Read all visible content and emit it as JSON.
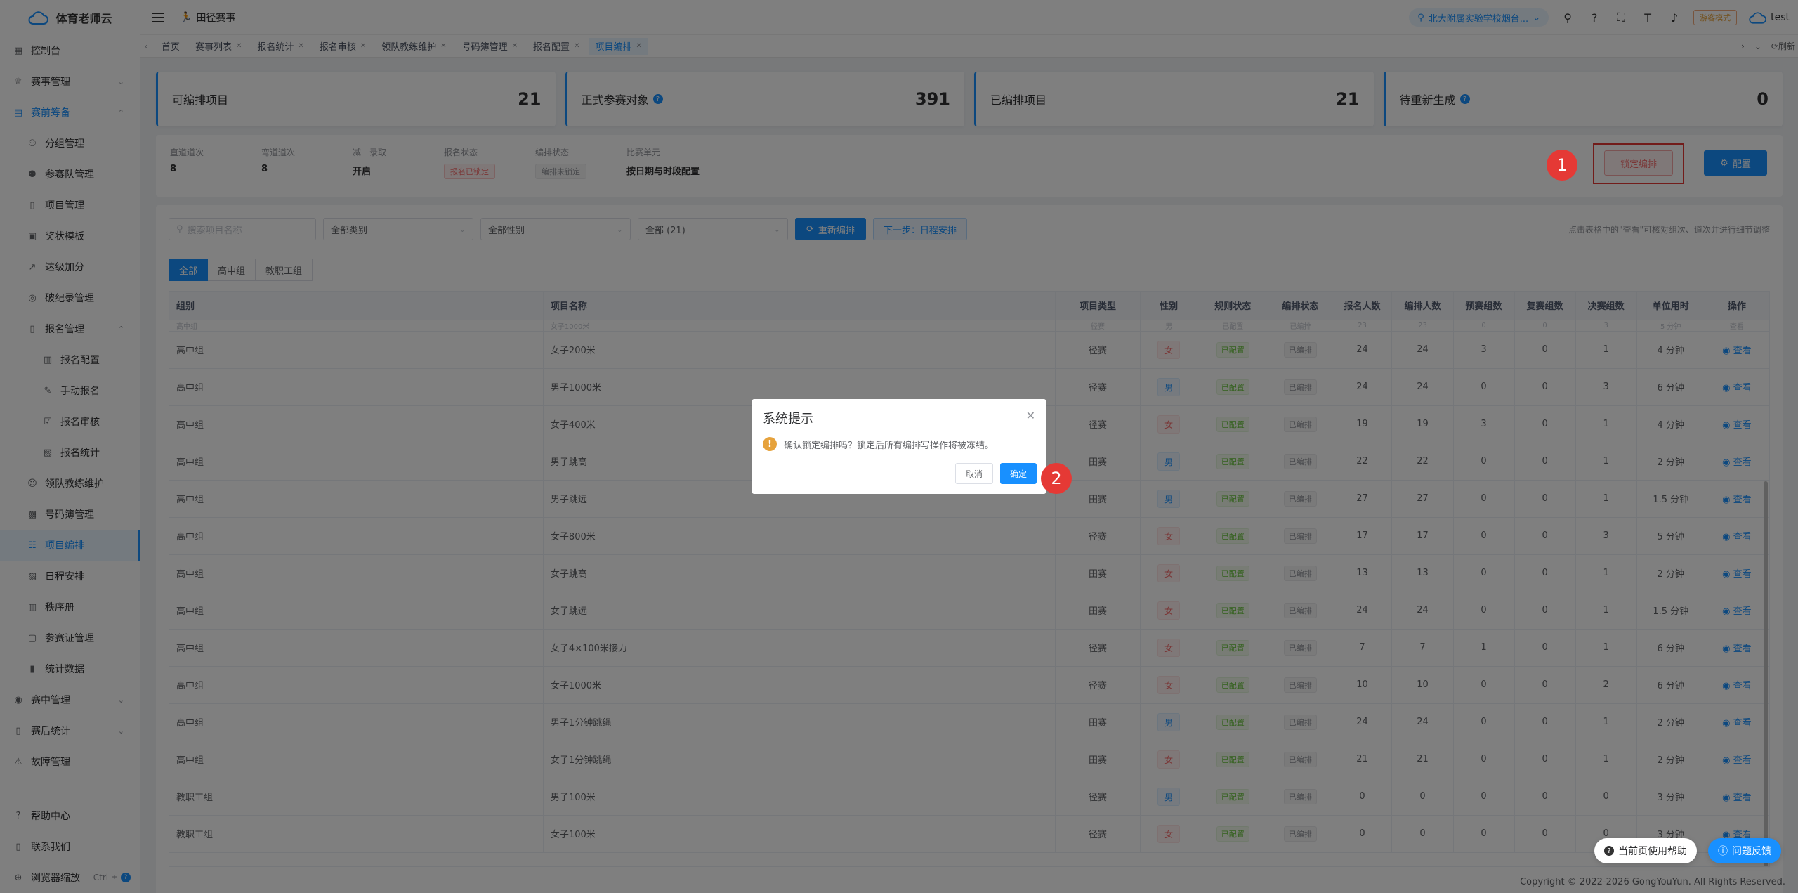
{
  "app": {
    "title": "体育老师云"
  },
  "sidebar": {
    "items": [
      {
        "label": "控制台",
        "icon": "dashboard-icon",
        "level": 0
      },
      {
        "label": "赛事管理",
        "icon": "trophy-icon",
        "level": 0,
        "arrow": "⌄"
      },
      {
        "label": "赛前筹备",
        "icon": "calendar-icon",
        "level": 0,
        "arrow": "⌃",
        "open": true
      },
      {
        "label": "分组管理",
        "icon": "group-icon",
        "level": 1
      },
      {
        "label": "参赛队管理",
        "icon": "team-icon",
        "level": 1
      },
      {
        "label": "项目管理",
        "icon": "doc-icon",
        "level": 1
      },
      {
        "label": "奖状模板",
        "icon": "certificate-icon",
        "level": 1
      },
      {
        "label": "达级加分",
        "icon": "chart-up-icon",
        "level": 1
      },
      {
        "label": "破纪录管理",
        "icon": "record-icon",
        "level": 1
      },
      {
        "label": "报名管理",
        "icon": "doc-icon",
        "level": 1,
        "arrow": "⌃"
      },
      {
        "label": "报名配置",
        "icon": "config-doc-icon",
        "level": 2
      },
      {
        "label": "手动报名",
        "icon": "manual-icon",
        "level": 2
      },
      {
        "label": "报名审核",
        "icon": "review-icon",
        "level": 2
      },
      {
        "label": "报名统计",
        "icon": "stats-doc-icon",
        "level": 2
      },
      {
        "label": "领队教练维护",
        "icon": "coach-icon",
        "level": 1
      },
      {
        "label": "号码簿管理",
        "icon": "number-book-icon",
        "level": 1
      },
      {
        "label": "项目编排",
        "icon": "schedule-icon",
        "level": 1,
        "active": true
      },
      {
        "label": "日程安排",
        "icon": "agenda-icon",
        "level": 1
      },
      {
        "label": "秩序册",
        "icon": "book-icon",
        "level": 1
      },
      {
        "label": "参赛证管理",
        "icon": "badge-icon",
        "level": 1
      },
      {
        "label": "统计数据",
        "icon": "bar-chart-icon",
        "level": 1
      },
      {
        "label": "赛中管理",
        "icon": "target-icon",
        "level": 0,
        "arrow": "⌄"
      },
      {
        "label": "赛后统计",
        "icon": "stats-icon",
        "level": 0,
        "arrow": "⌄"
      },
      {
        "label": "故障管理",
        "icon": "fault-icon",
        "level": 0
      }
    ],
    "bottom": [
      {
        "label": "帮助中心",
        "icon": "help-icon"
      },
      {
        "label": "联系我们",
        "icon": "phone-icon"
      },
      {
        "label": "浏览器缩放",
        "icon": "zoom-icon",
        "shortcut": "Ctrl ±"
      }
    ]
  },
  "topbar": {
    "breadcrumb": "田径赛事",
    "school": "北大附属实验学校烟台...",
    "mode": "游客模式",
    "user": "test"
  },
  "tags": [
    {
      "label": "首页",
      "closable": false
    },
    {
      "label": "赛事列表",
      "closable": true
    },
    {
      "label": "报名统计",
      "closable": true
    },
    {
      "label": "报名审核",
      "closable": true
    },
    {
      "label": "领队教练维护",
      "closable": true
    },
    {
      "label": "号码簿管理",
      "closable": true
    },
    {
      "label": "报名配置",
      "closable": true
    },
    {
      "label": "项目编排",
      "closable": true,
      "active": true
    }
  ],
  "tags_right": {
    "refresh": "刷新"
  },
  "stats": [
    {
      "label": "可编排项目",
      "value": "21",
      "help": false
    },
    {
      "label": "正式参赛对象",
      "value": "391",
      "help": true
    },
    {
      "label": "已编排项目",
      "value": "21",
      "help": false
    },
    {
      "label": "待重新生成",
      "value": "0",
      "help": true
    }
  ],
  "info": {
    "cols": [
      {
        "k": "直道道次",
        "v": "8"
      },
      {
        "k": "弯道道次",
        "v": "8"
      },
      {
        "k": "减一录取",
        "v": "开启"
      },
      {
        "k": "报名状态",
        "pill": "报名已锁定",
        "pill_style": "red"
      },
      {
        "k": "编排状态",
        "pill": "编排未锁定",
        "pill_style": "grey"
      },
      {
        "k": "比赛单元",
        "v": "按日期与时段配置"
      }
    ],
    "lock_button": "锁定编排",
    "config_button": "配置"
  },
  "filters": {
    "search_placeholder": "搜索项目名称",
    "category": "全部类别",
    "gender": "全部性别",
    "status": "全部 (21)",
    "regen_button": "重新编排",
    "next_button": "下一步：日程安排",
    "tip": "点击表格中的\"查看\"可核对组次、道次并进行细节调整"
  },
  "group_tabs": [
    "全部",
    "高中组",
    "教职工组"
  ],
  "table": {
    "headers": [
      "组别",
      "项目名称",
      "项目类型",
      "性别",
      "规则状态",
      "编排状态",
      "报名人数",
      "编排人数",
      "预赛组数",
      "复赛组数",
      "决赛组数",
      "单位用时",
      "操作"
    ],
    "partial_row": [
      "高中组",
      "女子1000米",
      "径赛",
      "男",
      "已配置",
      "已编排",
      "23",
      "23",
      "0",
      "0",
      "3",
      "5 分钟",
      "查看"
    ],
    "rows": [
      [
        "高中组",
        "女子200米",
        "径赛",
        "女",
        "已配置",
        "已编排",
        "24",
        "24",
        "3",
        "0",
        "1",
        "4 分钟",
        "查看"
      ],
      [
        "高中组",
        "男子1000米",
        "径赛",
        "男",
        "已配置",
        "已编排",
        "24",
        "24",
        "0",
        "0",
        "3",
        "6 分钟",
        "查看"
      ],
      [
        "高中组",
        "女子400米",
        "径赛",
        "女",
        "已配置",
        "已编排",
        "19",
        "19",
        "3",
        "0",
        "1",
        "4 分钟",
        "查看"
      ],
      [
        "高中组",
        "男子跳高",
        "田赛",
        "男",
        "已配置",
        "已编排",
        "22",
        "22",
        "0",
        "0",
        "1",
        "2 分钟",
        "查看"
      ],
      [
        "高中组",
        "男子跳远",
        "田赛",
        "男",
        "已配置",
        "已编排",
        "27",
        "27",
        "0",
        "0",
        "1",
        "1.5 分钟",
        "查看"
      ],
      [
        "高中组",
        "女子800米",
        "径赛",
        "女",
        "已配置",
        "已编排",
        "17",
        "17",
        "0",
        "0",
        "3",
        "5 分钟",
        "查看"
      ],
      [
        "高中组",
        "女子跳高",
        "田赛",
        "女",
        "已配置",
        "已编排",
        "13",
        "13",
        "0",
        "0",
        "1",
        "2 分钟",
        "查看"
      ],
      [
        "高中组",
        "女子跳远",
        "田赛",
        "女",
        "已配置",
        "已编排",
        "24",
        "24",
        "0",
        "0",
        "1",
        "1.5 分钟",
        "查看"
      ],
      [
        "高中组",
        "女子4×100米接力",
        "径赛",
        "女",
        "已配置",
        "已编排",
        "7",
        "7",
        "1",
        "0",
        "1",
        "6 分钟",
        "查看"
      ],
      [
        "高中组",
        "女子1000米",
        "径赛",
        "女",
        "已配置",
        "已编排",
        "10",
        "10",
        "0",
        "0",
        "2",
        "6 分钟",
        "查看"
      ],
      [
        "高中组",
        "男子1分钟跳绳",
        "田赛",
        "男",
        "已配置",
        "已编排",
        "24",
        "24",
        "0",
        "0",
        "1",
        "2 分钟",
        "查看"
      ],
      [
        "高中组",
        "女子1分钟跳绳",
        "田赛",
        "女",
        "已配置",
        "已编排",
        "21",
        "21",
        "0",
        "0",
        "1",
        "2 分钟",
        "查看"
      ],
      [
        "教职工组",
        "男子100米",
        "径赛",
        "男",
        "已配置",
        "已编排",
        "0",
        "0",
        "0",
        "0",
        "0",
        "3 分钟",
        "查看"
      ],
      [
        "教职工组",
        "女子100米",
        "径赛",
        "女",
        "已配置",
        "已编排",
        "0",
        "0",
        "0",
        "0",
        "0",
        "3 分钟",
        "查看"
      ]
    ]
  },
  "footer": "Copyright © 2022-2026 GongYouYun. All Rights Reserved.",
  "float": {
    "help": "当前页使用帮助",
    "feedback": "问题反馈"
  },
  "dialog": {
    "title": "系统提示",
    "message": "确认锁定编排吗？锁定后所有编排写操作将被冻结。",
    "cancel": "取消",
    "ok": "确定"
  },
  "steps": [
    "1",
    "2"
  ],
  "colors": {
    "primary": "#1890ff",
    "danger": "#f56c6c",
    "step": "#e53935"
  }
}
